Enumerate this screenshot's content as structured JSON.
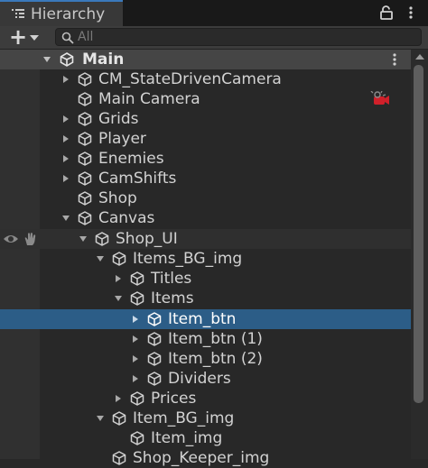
{
  "panel": {
    "title": "Hierarchy",
    "icons": {
      "tab": "hierarchy-list-icon",
      "lock": "lock-icon",
      "menu": "kebab-menu-icon"
    }
  },
  "toolbar": {
    "add_label": "+",
    "search_placeholder": "All",
    "search_value": ""
  },
  "scene": {
    "name": "Main",
    "icon": "unity-logo-icon"
  },
  "tree": {
    "rows": [
      {
        "label": "CM_StateDrivenCamera",
        "depth": 1,
        "arrow": "collapsed"
      },
      {
        "label": "Main Camera",
        "depth": 1,
        "arrow": "none",
        "extra": "camera-gizmo-icon"
      },
      {
        "label": "Grids",
        "depth": 1,
        "arrow": "collapsed"
      },
      {
        "label": "Player",
        "depth": 1,
        "arrow": "collapsed"
      },
      {
        "label": "Enemies",
        "depth": 1,
        "arrow": "collapsed"
      },
      {
        "label": "CamShifts",
        "depth": 1,
        "arrow": "collapsed"
      },
      {
        "label": "Shop",
        "depth": 1,
        "arrow": "none"
      },
      {
        "label": "Canvas",
        "depth": 1,
        "arrow": "expanded"
      },
      {
        "label": "Shop_UI",
        "depth": 2,
        "arrow": "expanded",
        "state": "hover",
        "gutter_icons": [
          "eye-icon",
          "hand-icon"
        ]
      },
      {
        "label": "Items_BG_img",
        "depth": 3,
        "arrow": "expanded"
      },
      {
        "label": "Titles",
        "depth": 4,
        "arrow": "collapsed"
      },
      {
        "label": "Items",
        "depth": 4,
        "arrow": "expanded"
      },
      {
        "label": "Item_btn",
        "depth": 5,
        "arrow": "collapsed",
        "state": "selected"
      },
      {
        "label": "Item_btn (1)",
        "depth": 5,
        "arrow": "collapsed"
      },
      {
        "label": "Item_btn (2)",
        "depth": 5,
        "arrow": "collapsed"
      },
      {
        "label": "Dividers",
        "depth": 5,
        "arrow": "collapsed"
      },
      {
        "label": "Prices",
        "depth": 4,
        "arrow": "collapsed"
      },
      {
        "label": "Item_BG_img",
        "depth": 3,
        "arrow": "expanded"
      },
      {
        "label": "Item_img",
        "depth": 4,
        "arrow": "none"
      },
      {
        "label": "Shop_Keeper_img",
        "depth": 3,
        "arrow": "none"
      }
    ]
  },
  "colors": {
    "selection": "#2c5d87",
    "tab_accent": "#3a79bb",
    "gizmo": "#d0202a"
  }
}
